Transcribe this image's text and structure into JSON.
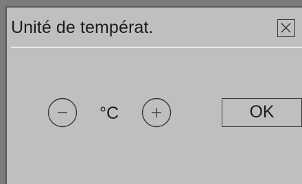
{
  "dialog": {
    "title": "Unité de températ.",
    "close_icon": "close-icon",
    "unit_value": "°C",
    "decrease_icon": "minus-icon",
    "increase_icon": "plus-icon",
    "ok_label": "OK"
  }
}
